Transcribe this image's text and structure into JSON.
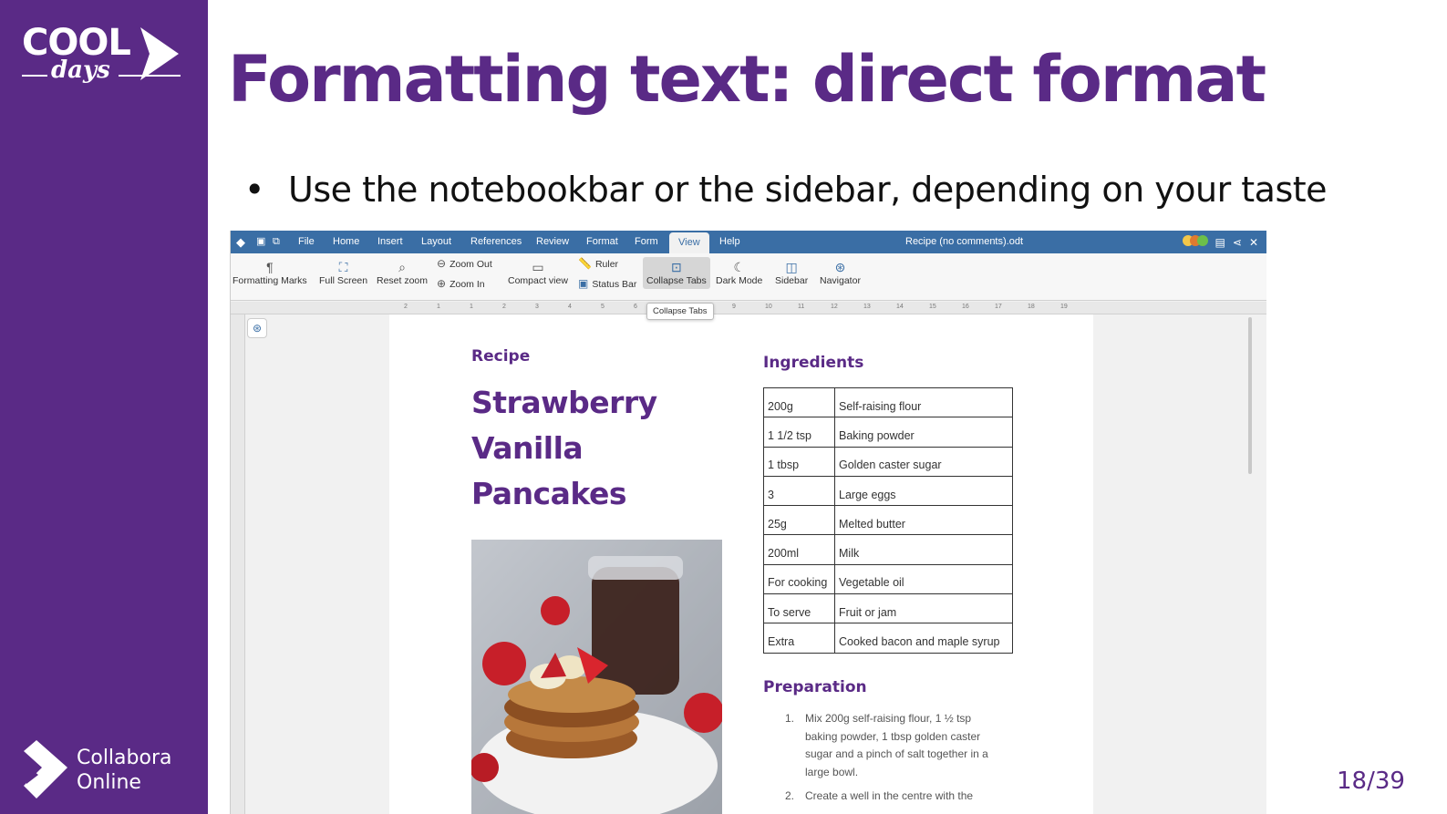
{
  "slide": {
    "title": "Formatting text: direct format",
    "bullet": "Use the notebookbar or the sidebar, depending on your taste",
    "page_number": "18/39"
  },
  "logos": {
    "cool_word": "COOL",
    "days_word": "days",
    "collabora_line1": "Collabora",
    "collabora_line2": "Online"
  },
  "colors": {
    "brand_purple": "#5a2a86",
    "menubar_blue": "#3a6ea5"
  },
  "app": {
    "menu": [
      "File",
      "Home",
      "Insert",
      "Layout",
      "References",
      "Review",
      "Format",
      "Form",
      "View",
      "Help"
    ],
    "active_menu": "View",
    "document_title": "Recipe (no comments).odt",
    "toolbar": {
      "formatting_marks": "Formatting Marks",
      "full_screen": "Full Screen",
      "reset_zoom": "Reset zoom",
      "zoom_out": "Zoom Out",
      "zoom_in": "Zoom In",
      "compact_view": "Compact view",
      "ruler": "Ruler",
      "status_bar": "Status Bar",
      "collapse_tabs": "Collapse Tabs",
      "dark_mode": "Dark Mode",
      "sidebar": "Sidebar",
      "navigator": "Navigator"
    },
    "tooltip": "Collapse Tabs",
    "ruler_ticks": [
      "2",
      "1",
      "1",
      "2",
      "3",
      "4",
      "5",
      "6",
      "7",
      "8",
      "9",
      "10",
      "11",
      "12",
      "13",
      "14",
      "15",
      "16",
      "17",
      "18",
      "19"
    ]
  },
  "document": {
    "recipe_label": "Recipe",
    "recipe_name_lines": [
      "Strawberry",
      "Vanilla",
      "Pancakes"
    ],
    "ingredients_title": "Ingredients",
    "ingredients": [
      {
        "qty": "200g",
        "item": "Self-raising flour"
      },
      {
        "qty": "1 1/2 tsp",
        "item": "Baking powder"
      },
      {
        "qty": "1 tbsp",
        "item": "Golden caster sugar"
      },
      {
        "qty": "3",
        "item": "Large eggs"
      },
      {
        "qty": "25g",
        "item": "Melted butter"
      },
      {
        "qty": "200ml",
        "item": "Milk"
      },
      {
        "qty": "For cooking",
        "item": "Vegetable oil"
      },
      {
        "qty": "To serve",
        "item": "Fruit or jam"
      },
      {
        "qty": "Extra",
        "item": "Cooked bacon and maple syrup"
      }
    ],
    "preparation_title": "Preparation",
    "preparation_steps": [
      {
        "n": "1.",
        "text": "Mix 200g self-raising flour, 1 ½ tsp baking powder, 1 tbsp golden caster sugar and a pinch of salt together in a large bowl."
      },
      {
        "n": "2.",
        "text": "Create a well in the centre with the"
      }
    ]
  }
}
